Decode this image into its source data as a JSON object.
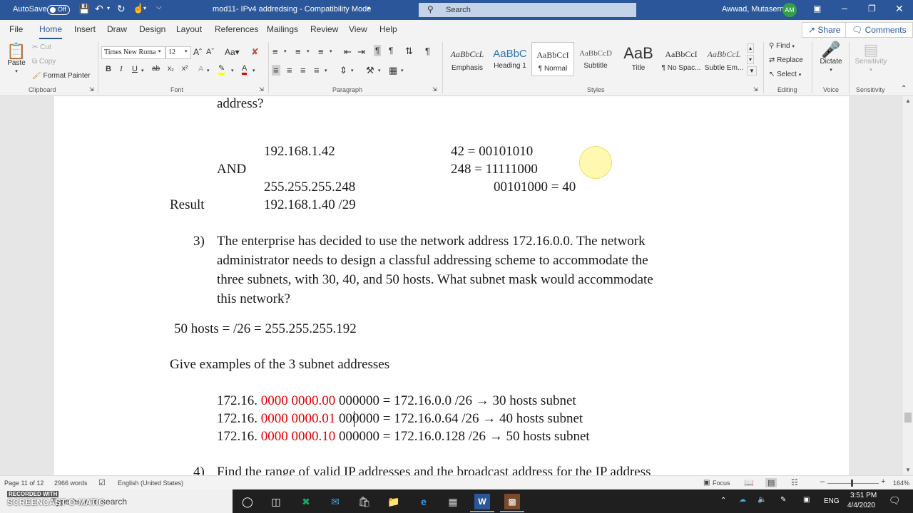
{
  "titlebar": {
    "autosave_label": "AutoSave",
    "autosave_state": "Off",
    "doc_title": "mod11- IPv4 addredsing  -  Compatibility Mode",
    "search_placeholder": "Search",
    "user_name": "Awwad, Mutasem",
    "user_initials": "AM"
  },
  "tabs": [
    "File",
    "Home",
    "Insert",
    "Draw",
    "Design",
    "Layout",
    "References",
    "Mailings",
    "Review",
    "View",
    "Help"
  ],
  "share_label": "Share",
  "comments_label": "Comments",
  "ribbon": {
    "clipboard": {
      "paste": "Paste",
      "cut": "Cut",
      "copy": "Copy",
      "format_painter": "Format Painter",
      "group": "Clipboard"
    },
    "font": {
      "name": "Times New Roma",
      "size": "12",
      "group": "Font"
    },
    "paragraph": {
      "group": "Paragraph"
    },
    "styles": {
      "group": "Styles",
      "items": [
        {
          "preview": "AaBbCcL",
          "name": "Emphasis"
        },
        {
          "preview": "AaBbC",
          "name": "Heading 1"
        },
        {
          "preview": "AaBbCcI",
          "name": "¶ Normal"
        },
        {
          "preview": "AaBbCcD",
          "name": "Subtitle"
        },
        {
          "preview": "AaB",
          "name": "Title"
        },
        {
          "preview": "AaBbCcI",
          "name": "¶ No Spac..."
        },
        {
          "preview": "AaBbCcL",
          "name": "Subtle Em..."
        }
      ]
    },
    "editing": {
      "find": "Find",
      "replace": "Replace",
      "select": "Select",
      "group": "Editing"
    },
    "voice": {
      "dictate": "Dictate",
      "group": "Voice"
    },
    "sensitivity": {
      "label": "Sensitivity",
      "group": "Sensitivity"
    }
  },
  "document": {
    "prev_tail": "address?",
    "calc": {
      "ip": "192.168.1.42",
      "and": "AND",
      "mask": "255.255.255.248",
      "result_label": "Result",
      "result": "192.168.1.40 /29",
      "bin1": "42 =   00101010",
      "bin2": "248 = 11111000",
      "bin3": "00101000 = 40"
    },
    "q3_num": "3)",
    "q3_lines": [
      "The enterprise has decided to use the network address 172.16.0.0. The network",
      "administrator needs to design a classful addressing scheme to accommodate the",
      "three subnets, with 30, 40, and 50 hosts. What subnet mask would accommodate",
      "this network?"
    ],
    "hosts_answer": "50 hosts = /26 = 255.255.255.192",
    "examples_heading": "Give examples of  the 3 subnet addresses",
    "subnets": [
      {
        "prefix": "172.16. ",
        "bits": "0000 0000.00",
        "rest": " 000000 = 172.16.0.0 /26 → 30 hosts subnet"
      },
      {
        "prefix": "172.16. ",
        "bits": "0000 0000.01",
        "rest": " 000000 = 172.16.0.64 /26 → 40 hosts subnet"
      },
      {
        "prefix": "172.16. ",
        "bits": "0000 0000.10",
        "rest": " 000000 = 172.16.0.128 /26 → 50 hosts subnet"
      }
    ],
    "q4_num": "4)",
    "q4_line": "Find the range of valid IP addresses and the broadcast address for the IP address"
  },
  "status": {
    "page": "Page 11 of 12",
    "words": "2966 words",
    "language": "English (United States)",
    "focus": "Focus",
    "zoom": "164%"
  },
  "taskbar": {
    "search_placeholder": "Type here to search",
    "watermark_top": "RECORDED WITH",
    "watermark": "SCREENCAST-O-MATIC",
    "lang": "ENG",
    "time": "3:51 PM",
    "date": "4/4/2020"
  }
}
